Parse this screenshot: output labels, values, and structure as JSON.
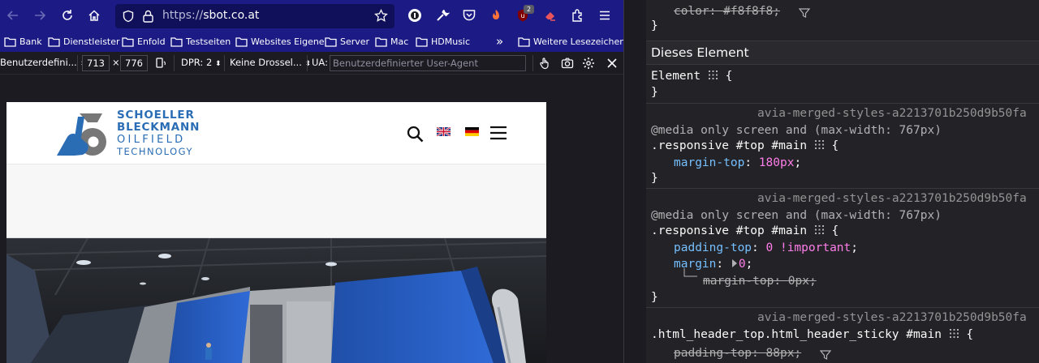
{
  "browser": {
    "url_proto": "https://",
    "url_host": "sbot.co.at",
    "ext_badge": "2",
    "bookmarks": [
      {
        "label": "Bank"
      },
      {
        "label": "Dienstleister"
      },
      {
        "label": "Enfold"
      },
      {
        "label": "Testseiten"
      },
      {
        "label": "Websites Eigene"
      },
      {
        "label": "Server"
      },
      {
        "label": "Mac"
      },
      {
        "label": "HDMusic"
      },
      {
        "label": "Weitere Lesezeichen"
      }
    ],
    "overflow_chevron": "»"
  },
  "rdm": {
    "device": "Benutzerdefini...",
    "width": "713",
    "times": "×",
    "height": "776",
    "dpr": "DPR: 2",
    "throttle": "Keine Drossel...",
    "ua_label": "UA:",
    "ua_placeholder": "Benutzerdefinierter User-Agent"
  },
  "site": {
    "logo_line1": "SCHOELLER",
    "logo_line2": "BLECKMANN",
    "logo_line3": "OILFIELD",
    "logo_line4": "TECHNOLOGY",
    "brand_color": "#2a6db5"
  },
  "devtools": {
    "top_strike_prop": "color:",
    "top_strike_val": "#f8f8f8;",
    "close_brace": "}",
    "section_title": "Dieses Element",
    "element_selector": "Element",
    "open_brace": "{",
    "rules": [
      {
        "source": "avia-merged-styles-a2213701b250d9b50fa",
        "media": "@media only screen and (max-width: 767px)",
        "selector": ".responsive #top #main",
        "decls": [
          {
            "prop": "margin-top",
            "val": "180px"
          }
        ]
      },
      {
        "source": "avia-merged-styles-a2213701b250d9b50fa",
        "media": "@media only screen and (max-width: 767px)",
        "selector": ".responsive #top #main",
        "decls": [
          {
            "prop": "padding-top",
            "val": "0",
            "important": "!important"
          },
          {
            "prop": "margin",
            "val": "0"
          },
          {
            "prop": "margin-top",
            "val": "0px"
          }
        ]
      },
      {
        "source": "avia-merged-styles-a2213701b250d9b50fa",
        "selector": ".html_header_top.html_header_sticky #main",
        "decls": [
          {
            "prop": "padding-top",
            "val": "88px"
          }
        ]
      }
    ]
  },
  "colors": {
    "toolbar": "#1c1b86",
    "devtools_bg": "#232327",
    "prop": "#75bfff",
    "value": "#ff7de9"
  }
}
